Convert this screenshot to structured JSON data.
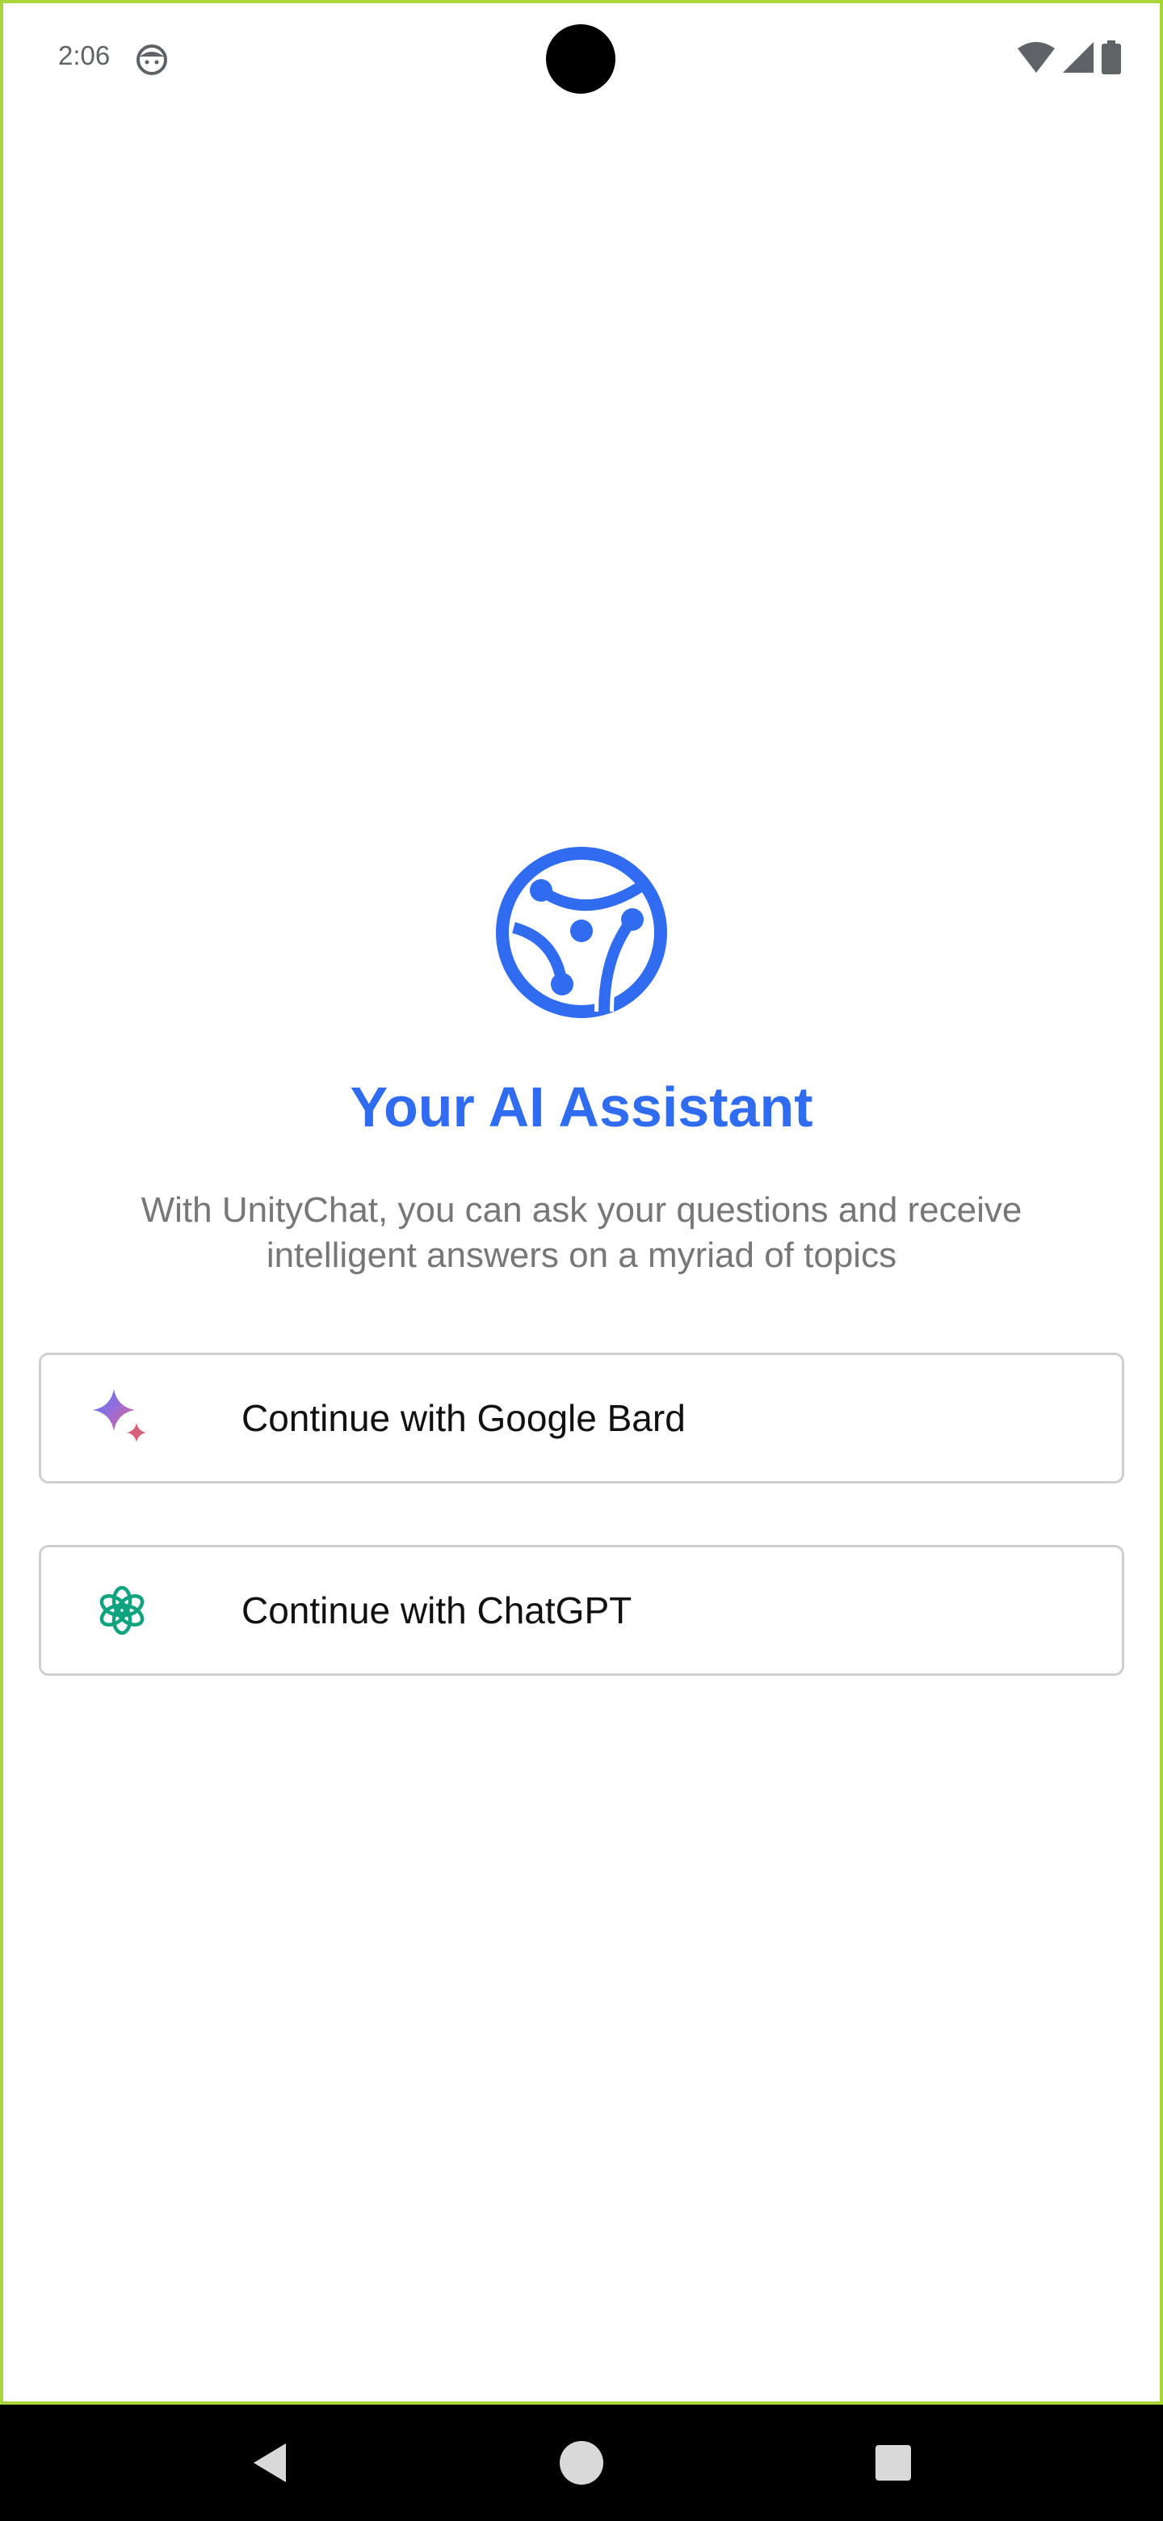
{
  "status_bar": {
    "time": "2:06",
    "app_icon": "face-icon",
    "right_icons": [
      "wifi-icon",
      "signal-icon",
      "battery-icon"
    ]
  },
  "hero": {
    "logo_icon": "unitychat-logo-icon",
    "title": "Your AI Assistant",
    "subtitle": "With UnityChat, you can ask your questions and receive intelligent answers on a myriad of topics"
  },
  "buttons": [
    {
      "label": "Continue with Google Bard",
      "icon": "google-bard-sparkle-icon"
    },
    {
      "label": "Continue with ChatGPT",
      "icon": "chatgpt-icon"
    }
  ],
  "nav_bar": {
    "items": [
      "back-icon",
      "home-icon",
      "recents-icon"
    ]
  },
  "colors": {
    "accent": "#2f6cf0",
    "subtitle_text": "#777777",
    "button_border": "#cfcfcf",
    "frame_border": "#a8d63a",
    "chatgpt_green": "#10a37f"
  }
}
